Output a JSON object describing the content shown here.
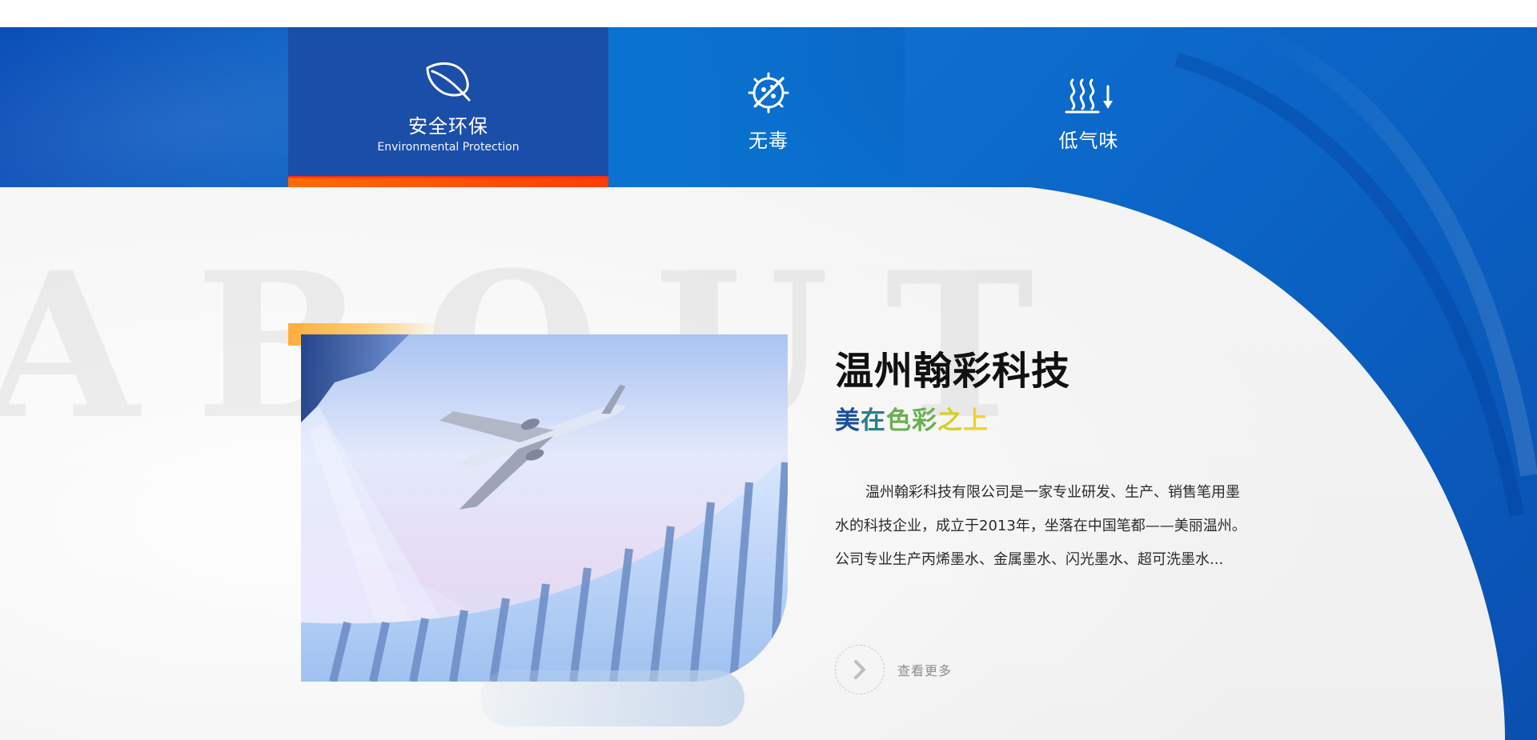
{
  "tabs": [
    {
      "label": "安全环保",
      "sublabel": "Environmental Protection",
      "icon": "leaf-icon",
      "active": true
    },
    {
      "label": "无毒",
      "sublabel": "",
      "icon": "virus-free-icon",
      "active": false
    },
    {
      "label": "低气味",
      "sublabel": "",
      "icon": "low-odor-icon",
      "active": false
    }
  ],
  "about": {
    "watermark": "ABOUT",
    "title": "温州翰彩科技",
    "subtitle": "美在色彩之上",
    "description": "温州翰彩科技有限公司是一家专业研发、生产、销售笔用墨水的科技企业，成立于2013年，坐落在中国笔都——美丽温州。公司专业生产丙烯墨水、金属墨水、闪光墨水、超可洗墨水...",
    "more_label": "查看更多"
  },
  "colors": {
    "blue_band": "#0a73d1",
    "active_tab": "#1b4ea8",
    "active_underline": "#ff3d00",
    "orange_accent": "#ffad3a",
    "subtitle_gradient": [
      "#1d4f9c",
      "#2b7f8a",
      "#6ab04f",
      "#d6cf2a",
      "#f2d12f"
    ]
  }
}
